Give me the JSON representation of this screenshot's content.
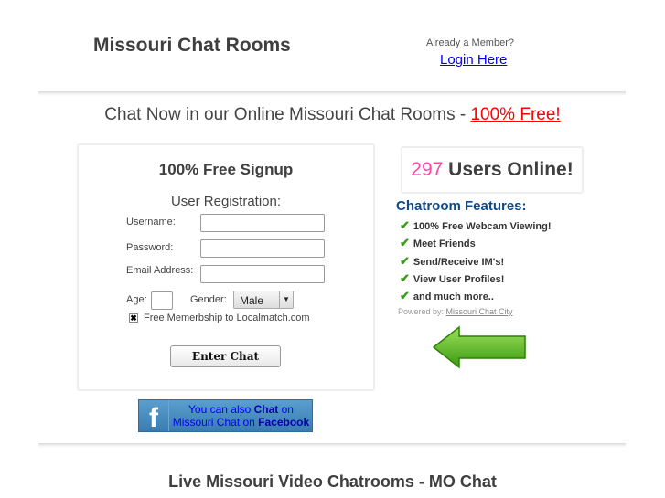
{
  "header": {
    "title": "Missouri Chat Rooms",
    "already_member": "Already a Member?",
    "login_link": "Login Here"
  },
  "tagline": {
    "text": "Chat Now in our Online Missouri Chat Rooms - ",
    "highlight": "100% Free!",
    "highlight_color": "#ff0000"
  },
  "signup": {
    "heading": "100% Free Signup",
    "subheading": "User Registration:",
    "username_label": "Username:",
    "password_label": "Password:",
    "email_label": "Email Address:",
    "username_value": "",
    "password_value": "",
    "email_value": "",
    "age_value": "",
    "age_label": "Age:",
    "gender_label": "Gender:",
    "gender_selected": "Male",
    "membership_label": "Free Memerbship to Localmatch.com",
    "membership_checked": true,
    "submit_label": "Enter Chat"
  },
  "facebook": {
    "line1_a": "You can also ",
    "line1_b": "Chat",
    "line1_c": " on",
    "line2_a": "Missouri Chat on ",
    "line2_b": "Facebook",
    "icon": "facebook-f-icon"
  },
  "online": {
    "count": "297",
    "label": " Users Online!",
    "count_color": "#ff44aa"
  },
  "features": {
    "heading": "Chatroom Features:",
    "items": [
      "100% Free Webcam Viewing!",
      "Meet Friends",
      "Send/Receive IM's!",
      "View User Profiles!",
      "and much more.."
    ],
    "icon": "checkmark-icon"
  },
  "powered": {
    "label": "Powered by: ",
    "link": "Missouri Chat City"
  },
  "arrow": {
    "icon": "green-left-arrow-icon",
    "color": "#4caf1a"
  },
  "footer": {
    "title": "Live Missouri Video Chatrooms - MO Chat"
  }
}
